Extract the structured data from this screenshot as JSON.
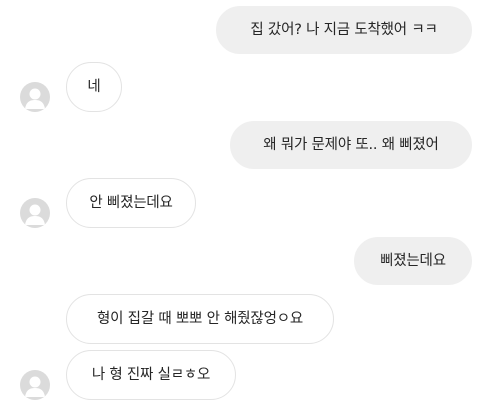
{
  "thread": {
    "messages": [
      {
        "from": "me",
        "text": "집 갔어? 나 지금 도착했어 ㅋㅋ"
      },
      {
        "from": "them",
        "text": "네"
      },
      {
        "from": "me",
        "text": "왜 뭐가 문제야 또.. 왜 삐졌어"
      },
      {
        "from": "them",
        "text": "안 삐졌는데요"
      },
      {
        "from": "me",
        "text": "삐졌는데요"
      },
      {
        "from": "them",
        "text": "형이 집갈 때 뽀뽀 안 해줬잖엉ㅇ요"
      },
      {
        "from": "them",
        "text": "나 형 진짜 실ㄹㅎ오"
      }
    ]
  },
  "colors": {
    "sent_bubble": "#efefef",
    "received_bubble_border": "#e3e3e3",
    "text": "#262626",
    "avatar": "#dbdbdb"
  },
  "icons": {
    "avatar": "default-profile-icon"
  }
}
